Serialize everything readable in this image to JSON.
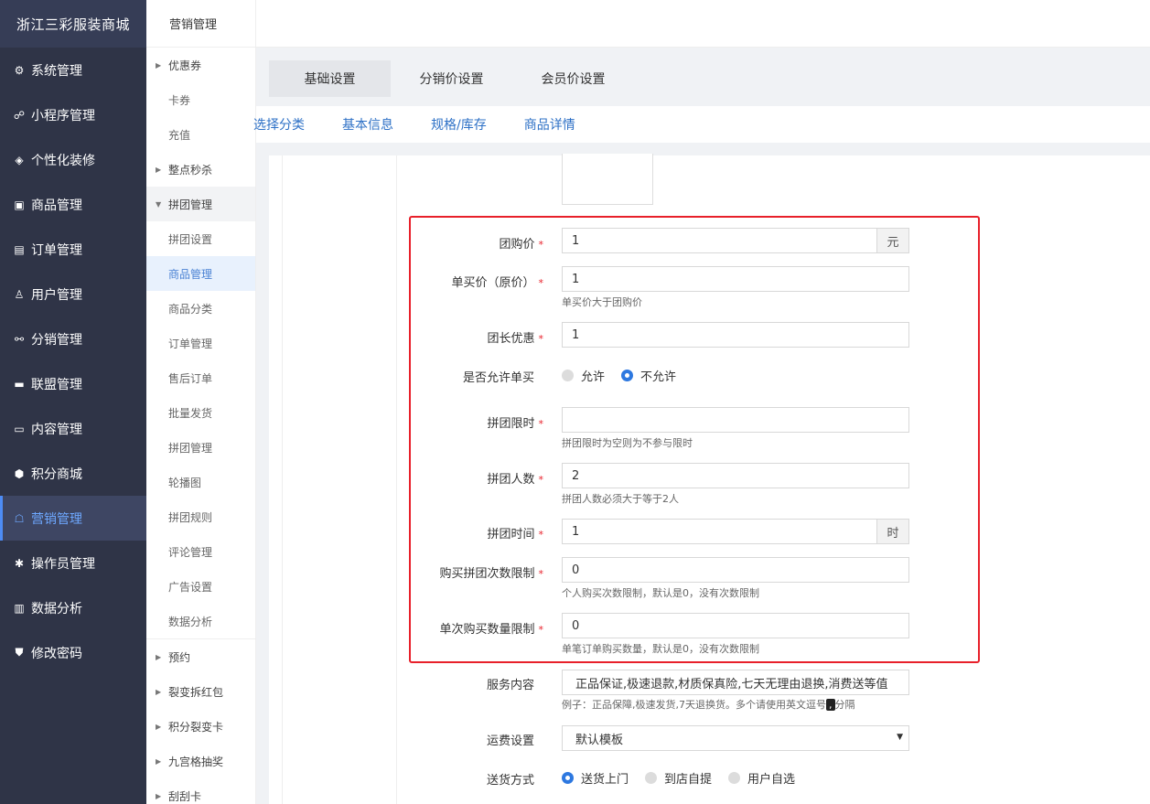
{
  "app": {
    "title": "浙江三彩服装商城"
  },
  "sidebar": {
    "items": [
      {
        "label": "系统管理",
        "icon": "⚙"
      },
      {
        "label": "小程序管理",
        "icon": "☍"
      },
      {
        "label": "个性化装修",
        "icon": "◈"
      },
      {
        "label": "商品管理",
        "icon": "▣"
      },
      {
        "label": "订单管理",
        "icon": "▤"
      },
      {
        "label": "用户管理",
        "icon": "♙"
      },
      {
        "label": "分销管理",
        "icon": "⚯"
      },
      {
        "label": "联盟管理",
        "icon": "▬"
      },
      {
        "label": "内容管理",
        "icon": "▭"
      },
      {
        "label": "积分商城",
        "icon": "⬢"
      },
      {
        "label": "营销管理",
        "icon": "☖"
      },
      {
        "label": "操作员管理",
        "icon": "✱"
      },
      {
        "label": "数据分析",
        "icon": "▥"
      },
      {
        "label": "修改密码",
        "icon": "⛊"
      }
    ],
    "active": "营销管理"
  },
  "submenu": {
    "title": "营销管理",
    "coupon": "优惠券",
    "card_coupon": "卡券",
    "recharge": "充值",
    "flash_sale": "整点秒杀",
    "group_buy": "拼团管理",
    "group_items": [
      "拼团设置",
      "商品管理",
      "商品分类",
      "订单管理",
      "售后订单",
      "批量发货",
      "拼团管理",
      "轮播图",
      "拼团规则",
      "评论管理",
      "广告设置",
      "数据分析"
    ],
    "group_active": "商品管理",
    "reservation": "预约",
    "red_packet": "裂变拆红包",
    "points_card": "积分裂变卡",
    "lottery": "九宫格抽奖",
    "scratch": "刮刮卡"
  },
  "tabs": {
    "primary": [
      "基础设置",
      "分销价设置",
      "会员价设置"
    ],
    "primary_active": "基础设置",
    "secondary": [
      "选择分类",
      "基本信息",
      "规格/库存",
      "商品详情"
    ]
  },
  "form": {
    "group_price": {
      "label": "团购价",
      "value": "1",
      "unit": "元"
    },
    "single_price": {
      "label": "单买价（原价）",
      "value": "1",
      "hint": "单买价大于团购价"
    },
    "leader_discount": {
      "label": "团长优惠",
      "value": "1"
    },
    "allow_single": {
      "label": "是否允许单买",
      "options": [
        "允许",
        "不允许"
      ],
      "selected": "不允许"
    },
    "time_limit": {
      "label": "拼团限时",
      "value": "",
      "hint": "拼团限时为空则为不参与限时"
    },
    "group_size": {
      "label": "拼团人数",
      "value": "2",
      "hint": "拼团人数必须大于等于2人"
    },
    "group_time": {
      "label": "拼团时间",
      "value": "1",
      "unit": "时"
    },
    "buy_limit": {
      "label": "购买拼团次数限制",
      "value": "0",
      "hint": "个人购买次数限制，默认是0，没有次数限制"
    },
    "qty_limit": {
      "label": "单次购买数量限制",
      "value": "0",
      "hint": "单笔订单购买数量，默认是0，没有次数限制"
    },
    "service": {
      "label": "服务内容",
      "value": "正品保证,极速退款,材质保真险,七天无理由退换,消费送等值",
      "hint_before": "例子：正品保障,极速发货,7天退换货。多个请使用英文逗号",
      "hint_mark": ",",
      "hint_after": "分隔"
    },
    "shipping": {
      "label": "运费设置",
      "value": "默认模板"
    },
    "delivery": {
      "label": "送货方式",
      "options": [
        "送货上门",
        "到店自提",
        "用户自选"
      ],
      "selected": "送货上门"
    }
  },
  "colors": {
    "sidebar_bg": "#2f3447",
    "accent": "#4d8cf5",
    "required": "#e8202a",
    "link": "#2d70c6"
  }
}
